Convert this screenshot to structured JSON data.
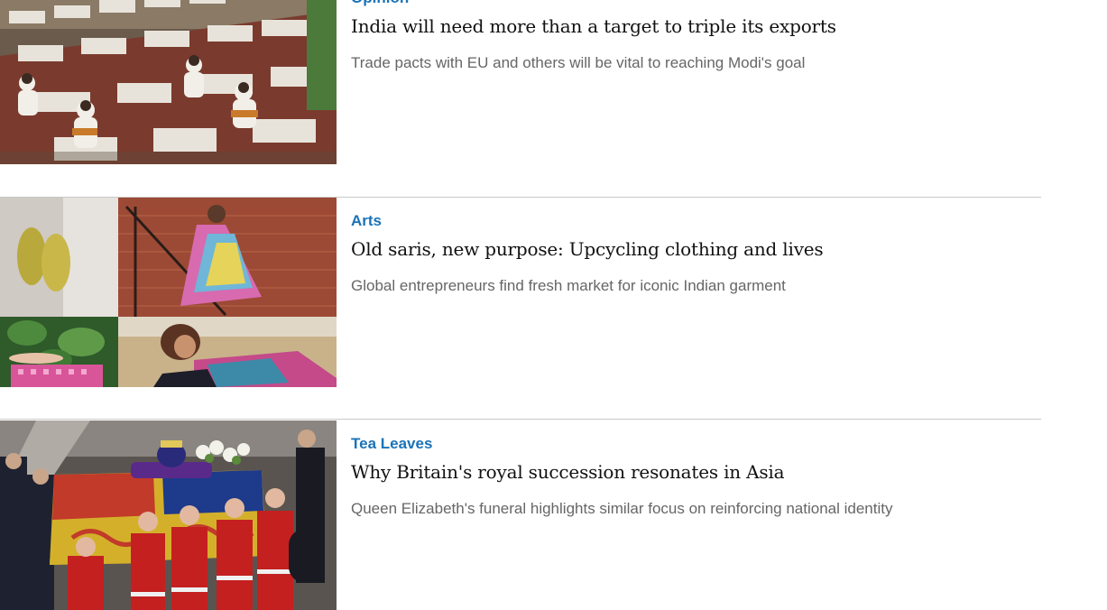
{
  "colors": {
    "kicker": "#1a73b8",
    "headline": "#111111",
    "summary": "#666666",
    "divider": "#c9c9c9"
  },
  "articles": [
    {
      "kicker": "Opinion",
      "headline": "India will need more than a target to triple its exports",
      "summary": "Trade pacts with EU and others will be vital to reaching Modi's goal",
      "image_alt": "Textile factory workers"
    },
    {
      "kicker": "Arts",
      "headline": "Old saris, new purpose: Upcycling clothing and lives",
      "summary": "Global entrepreneurs find fresh market for iconic Indian garment",
      "image_alt": "Upcycled sari fashion collage"
    },
    {
      "kicker": "Tea Leaves",
      "headline": "Why Britain's royal succession resonates in Asia",
      "summary": "Queen Elizabeth's funeral highlights similar focus on reinforcing national identity",
      "image_alt": "Royal coffin carried by guards"
    }
  ]
}
